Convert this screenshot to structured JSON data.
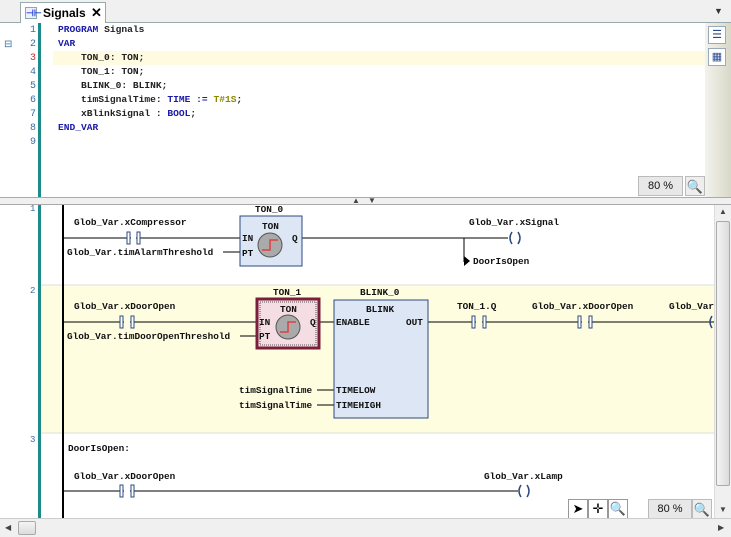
{
  "tab": {
    "title": "Signals",
    "close": "✕",
    "icon": "ladder-pou-icon"
  },
  "declaration": {
    "line_numbers": [
      "1",
      "2",
      "3",
      "4",
      "5",
      "6",
      "7",
      "8",
      "9"
    ],
    "lines": [
      [
        {
          "t": "PROGRAM",
          "c": "kw"
        },
        {
          "t": " Signals",
          "c": ""
        }
      ],
      [
        {
          "t": "VAR",
          "c": "kw"
        }
      ],
      [
        {
          "t": "    TON_0: TON;",
          "c": ""
        }
      ],
      [
        {
          "t": "    TON_1: TON;",
          "c": ""
        }
      ],
      [
        {
          "t": "    BLINK_0: BLINK;",
          "c": ""
        }
      ],
      [
        {
          "t": "    timSignalTime: ",
          "c": ""
        },
        {
          "t": "TIME",
          "c": "kw"
        },
        {
          "t": " := ",
          "c": "kw"
        },
        {
          "t": "T#1S",
          "c": "lit"
        },
        {
          "t": ";",
          "c": ""
        }
      ],
      [
        {
          "t": "    xBlinkSignal : ",
          "c": ""
        },
        {
          "t": "BOOL",
          "c": "kw"
        },
        {
          "t": ";",
          "c": ""
        }
      ],
      [
        {
          "t": "END_VAR",
          "c": "kw"
        }
      ],
      []
    ],
    "zoom": "80 %"
  },
  "ladder": {
    "network_numbers": [
      "1",
      "2",
      "3"
    ],
    "n1": {
      "contact": "Glob_Var.xCompressor",
      "pt": "Glob_Var.timAlarmThreshold",
      "instance": "TON_0",
      "fb": "TON",
      "in": "IN",
      "pt_pin": "PT",
      "q": "Q",
      "coil": "Glob_Var.xSignal",
      "jump": "DoorIsOpen"
    },
    "n2": {
      "contact": "Glob_Var.xDoorOpen",
      "pt": "Glob_Var.timDoorOpenThreshold",
      "ton_instance": "TON_1",
      "ton_fb": "TON",
      "in": "IN",
      "pt_pin": "PT",
      "q": "Q",
      "blink_instance": "BLINK_0",
      "blink_fb": "BLINK",
      "enable": "ENABLE",
      "out": "OUT",
      "timelow": "TIMELOW",
      "timehigh": "TIMEHIGH",
      "timelow_var": "timSignalTime",
      "timehigh_var": "timSignalTime",
      "contact2": "TON_1.Q",
      "contact3": "Glob_Var.xDoorOpen",
      "coil": "Glob_Var.xBlinkSignal"
    },
    "n3": {
      "label": "DoorIsOpen:",
      "contact": "Glob_Var.xDoorOpen",
      "coil": "Glob_Var.xLamp"
    },
    "zoom": "80 %"
  },
  "colors": {
    "rung_highlight": "#fefde0",
    "selected_box": "#7a1f3a",
    "fb_fill": "#dde6f4"
  }
}
